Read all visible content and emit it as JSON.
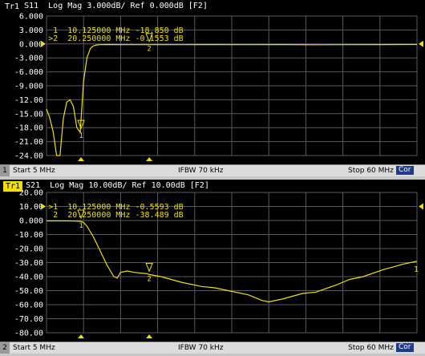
{
  "colors": {
    "trace": "#f0e000",
    "grid": "#5a5a5a",
    "background": "#000000",
    "statusbar": "#dcdcdc",
    "cor_badge": "#1e3a8a"
  },
  "channel1": {
    "trace_id": "Tr1",
    "header": "S11  Log Mag 3.000dB/ Ref 0.000dB [F2]",
    "markers": [
      {
        "prefix": " 1",
        "freq": "10.125000 MHz",
        "value": "-18.850 dB"
      },
      {
        "prefix": ">2",
        "freq": "20.250000 MHz",
        "value": "-0.1553 dB"
      }
    ],
    "status": {
      "num": "1",
      "start": "Start 5 MHz",
      "ifbw": "IFBW 70 kHz",
      "stop": "Stop 60 MHz",
      "cor": "Cor"
    },
    "chart_data": {
      "type": "line",
      "title": "S11 Log Mag 3.000dB/ Ref 0.000dB [F2]",
      "xlabel": "",
      "ylabel": "",
      "xlim": [
        5,
        60
      ],
      "ylim": [
        -24,
        6
      ],
      "yticks": [
        "6.000",
        "3.000",
        "0.000",
        "-3.000",
        "-6.000",
        "-9.000",
        "-12.00",
        "-15.00",
        "-18.00",
        "-21.00",
        "-24.00"
      ],
      "yticks_values": [
        6,
        3,
        0,
        -3,
        -6,
        -9,
        -12,
        -15,
        -18,
        -21,
        -24
      ],
      "ref_value": 0,
      "grid": true,
      "series": [
        {
          "x": [
            5,
            5.5,
            6,
            6.5,
            7,
            7.5,
            8,
            8.5,
            9,
            9.5,
            10,
            10.5,
            11,
            11.5,
            12,
            12.5,
            13,
            14,
            15,
            17,
            20,
            25,
            30,
            35,
            40,
            45,
            50,
            55,
            60
          ],
          "y": [
            -14,
            -16,
            -19,
            -24,
            -24,
            -16,
            -12.5,
            -12,
            -13.5,
            -18,
            -19,
            -8,
            -3,
            -1,
            -0.4,
            -0.2,
            -0.15,
            -0.12,
            -0.13,
            -0.15,
            -0.1553,
            -0.15,
            -0.14,
            -0.15,
            -0.14,
            -0.18,
            -0.16,
            -0.14,
            -0.12
          ]
        }
      ],
      "markers": [
        {
          "label": "1",
          "x": 10.125,
          "y": -18.85
        },
        {
          "label": "2",
          "x": 20.25,
          "y": -0.1553
        }
      ]
    }
  },
  "channel2": {
    "trace_id": "Tr1",
    "header": "S21  Log Mag 10.00dB/ Ref 10.00dB [F2]",
    "markers": [
      {
        "prefix": ">1",
        "freq": "10.125000 MHz",
        "value": "-0.5593 dB"
      },
      {
        "prefix": " 2",
        "freq": "20.250000 MHz",
        "value": "-38.489 dB"
      }
    ],
    "right_marker_label": "1",
    "status": {
      "num": "2",
      "start": "Start 5 MHz",
      "ifbw": "IFBW 70 kHz",
      "stop": "Stop 60 MHz",
      "cor": "Cor"
    },
    "chart_data": {
      "type": "line",
      "title": "S21 Log Mag 10.00dB/ Ref 10.00dB [F2]",
      "xlabel": "",
      "ylabel": "",
      "xlim": [
        5,
        60
      ],
      "ylim": [
        -80,
        20
      ],
      "yticks": [
        "20.00",
        "10.00",
        "0.000",
        "-10.00",
        "-20.00",
        "-30.00",
        "-40.00",
        "-50.00",
        "-60.00",
        "-70.00",
        "-80.00"
      ],
      "yticks_values": [
        20,
        10,
        0,
        -10,
        -20,
        -30,
        -40,
        -50,
        -60,
        -70,
        -80
      ],
      "ref_value": 10,
      "grid": true,
      "series": [
        {
          "x": [
            5,
            6,
            7,
            8,
            9,
            9.5,
            10,
            10.125,
            10.5,
            11,
            12,
            13,
            14,
            15,
            15.5,
            16,
            17,
            18,
            20,
            20.25,
            22,
            25,
            28,
            30,
            32,
            35,
            37,
            38,
            40,
            43,
            45,
            48,
            50,
            52,
            55,
            58,
            60
          ],
          "y": [
            -0.3,
            -0.3,
            -0.3,
            -0.3,
            -0.4,
            -0.5,
            -0.55,
            -0.5593,
            -1.5,
            -4,
            -12,
            -22,
            -32,
            -40,
            -41,
            -37,
            -36,
            -37,
            -38,
            -38.489,
            -40,
            -44,
            -47,
            -48,
            -50,
            -53,
            -57,
            -58,
            -56,
            -52,
            -51,
            -46,
            -42,
            -40,
            -35,
            -31,
            -29
          ]
        }
      ],
      "markers": [
        {
          "label": "1",
          "x": 10.125,
          "y": -0.5593
        },
        {
          "label": "2",
          "x": 20.25,
          "y": -38.489
        }
      ]
    }
  }
}
